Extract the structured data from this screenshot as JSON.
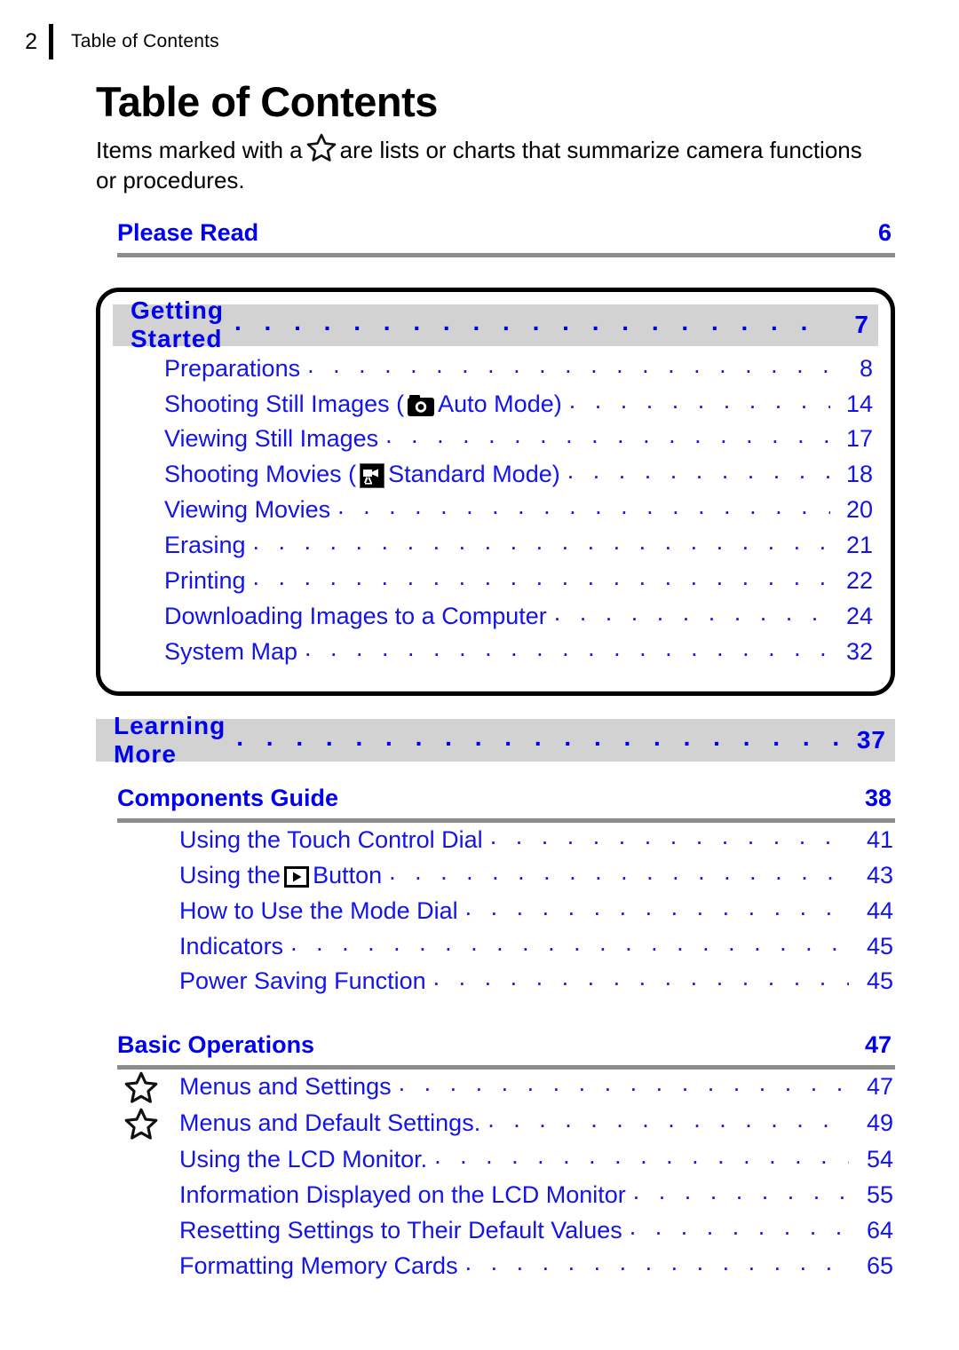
{
  "header": {
    "page_number": "2",
    "title": "Table of Contents"
  },
  "doc": {
    "title": "Table of Contents",
    "intro_before": "Items marked with a",
    "intro_after": "are lists or charts that summarize camera functions or procedures."
  },
  "colors": {
    "link_blue": "#0000EE",
    "entry_blue": "#1414E8",
    "banner_gray": "#D2D2D2",
    "rule_gray": "#8C8C8C",
    "box_black": "#000000"
  },
  "icons": {
    "star": "star-icon",
    "camera": "camera-icon",
    "movie_camera": "movie-camera-icon",
    "playback": "playback-button-icon"
  },
  "sections": [
    {
      "id": "please-read",
      "kind": "heading",
      "label": "Please Read",
      "page": "6"
    },
    {
      "id": "getting-started",
      "kind": "boxed-banner",
      "label": "Getting Started",
      "page": "7",
      "entries": [
        {
          "label": "Preparations",
          "page": "8",
          "icon": null
        },
        {
          "label_pre": "Shooting Still Images (",
          "icon": "camera-icon",
          "label_post": "Auto Mode)",
          "page": "14"
        },
        {
          "label": "Viewing Still Images",
          "page": "17",
          "icon": null
        },
        {
          "label_pre": "Shooting Movies (",
          "icon": "movie-camera-icon",
          "label_post": "Standard Mode)",
          "page": "18"
        },
        {
          "label": "Viewing Movies",
          "page": "20",
          "icon": null
        },
        {
          "label": "Erasing",
          "page": "21",
          "icon": null
        },
        {
          "label": "Printing",
          "page": "22",
          "icon": null
        },
        {
          "label": "Downloading Images to a Computer",
          "page": "24",
          "icon": null
        },
        {
          "label": "System Map",
          "page": "32",
          "icon": null
        }
      ]
    },
    {
      "id": "learning-more",
      "kind": "banner",
      "label": "Learning More",
      "page": "37"
    },
    {
      "id": "components-guide",
      "kind": "heading",
      "label": "Components Guide",
      "page": "38",
      "entries": [
        {
          "label": "Using the Touch Control Dial",
          "page": "41",
          "icon": null
        },
        {
          "label_pre": "Using the",
          "icon": "playback-button-icon",
          "label_post": "Button",
          "page": "43"
        },
        {
          "label": "How to Use the Mode Dial",
          "page": "44",
          "icon": null
        },
        {
          "label": "Indicators",
          "page": "45",
          "icon": null
        },
        {
          "label": "Power Saving Function",
          "page": "45",
          "icon": null
        }
      ]
    },
    {
      "id": "basic-operations",
      "kind": "heading",
      "label": "Basic Operations",
      "page": "47",
      "entries": [
        {
          "label": "Menus and Settings",
          "page": "47",
          "marker": "star-icon"
        },
        {
          "label": "Menus and Default Settings.",
          "page": "49",
          "marker": "star-icon"
        },
        {
          "label": "Using the LCD Monitor.",
          "page": "54",
          "marker": null
        },
        {
          "label": "Information Displayed on the LCD Monitor",
          "page": "55",
          "marker": null
        },
        {
          "label": "Resetting Settings to Their Default Values",
          "page": "64",
          "marker": null
        },
        {
          "label": "Formatting Memory Cards",
          "page": "65",
          "marker": null
        }
      ]
    }
  ],
  "leader_dots": ". . . . . . . . . . . . . . . . . . . . . . . . . . . . . . . . . . . . . . . . . . . . . . . . . . . . . . . . . . . . . . ."
}
